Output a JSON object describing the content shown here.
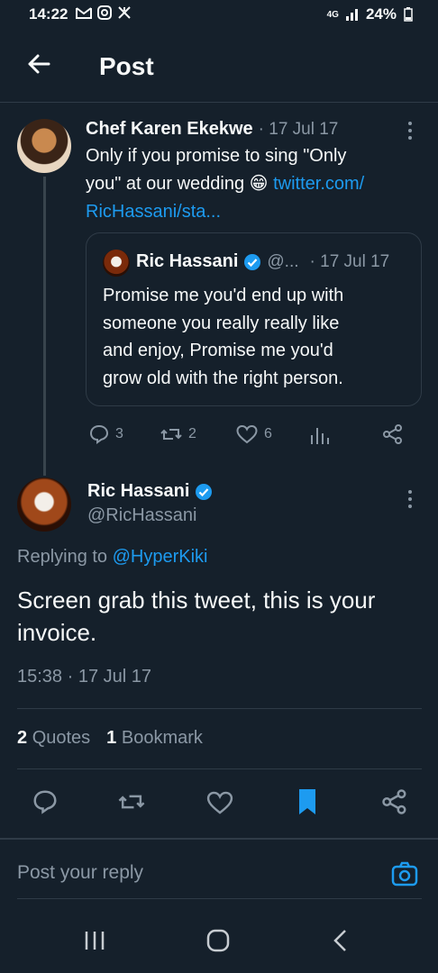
{
  "status_bar": {
    "time": "14:22",
    "network": "4G",
    "battery": "24%"
  },
  "header": {
    "title": "Post"
  },
  "parent_tweet": {
    "author": "Chef Karen Ekekwe",
    "date": "· 17 Jul 17",
    "text_plain": "Only if you promise to sing \"Only you\" at our wedding 😁 ",
    "link_text": "twitter.com/RicHassani/sta...",
    "line1": "Only if you promise to sing \"Only",
    "line2": "you\" at our wedding 😁 ",
    "line2_link": "twitter.com/",
    "line3_link": "RicHassani/sta...",
    "quote": {
      "author": "Ric Hassani",
      "handle": "@...",
      "date": "· 17 Jul 17",
      "lines": [
        "Promise me you'd end up with",
        "someone you really really like",
        "and enjoy, Promise me you'd",
        "grow old with the right person."
      ]
    },
    "actions": {
      "replies": "3",
      "reposts": "2",
      "likes": "6"
    }
  },
  "main_tweet": {
    "author": "Ric Hassani",
    "handle": "@RicHassani",
    "replying_prefix": "Replying to ",
    "replying_to": "@HyperKiki",
    "line1": "Screen grab this tweet, this is your",
    "line2": "invoice.",
    "timestamp": "15:38 · 17 Jul 17",
    "quotes_count": "2",
    "quotes_label": "Quotes",
    "bookmarks_count": "1",
    "bookmarks_label": "Bookmark"
  },
  "reply_box": {
    "placeholder": "Post your reply"
  },
  "colors": {
    "background": "#15202b",
    "accent": "#1d9bf0",
    "muted": "#8b98a5"
  }
}
